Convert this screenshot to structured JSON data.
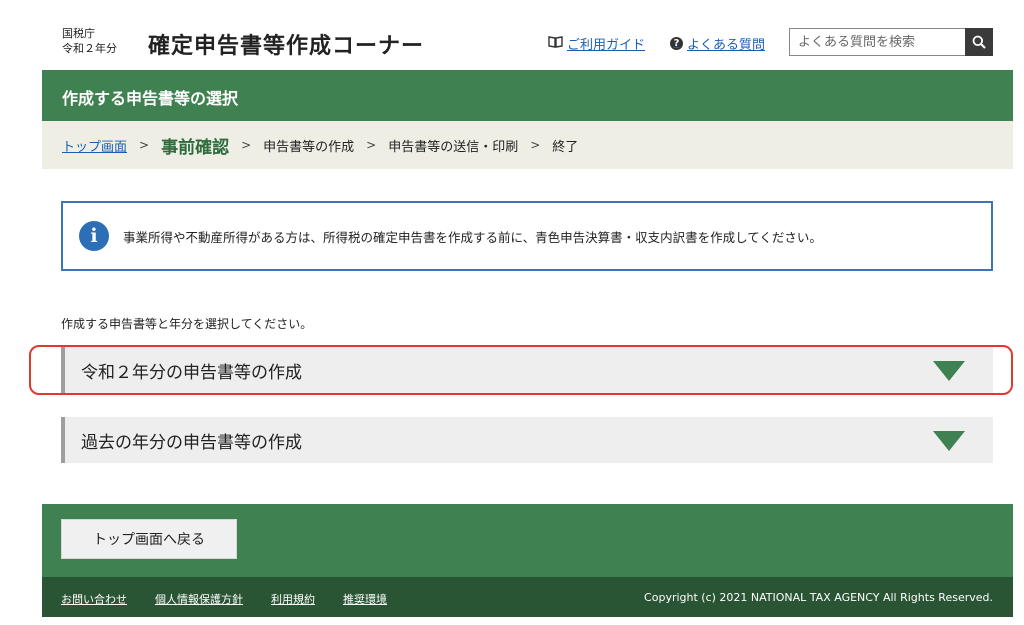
{
  "header": {
    "agency_line1": "国税庁",
    "agency_line2": "令和２年分",
    "title": "確定申告書等作成コーナー",
    "guide_link": "ご利用ガイド",
    "faq_link": "よくある質問",
    "search_placeholder": "よくある質問を検索"
  },
  "page": {
    "heading": "作成する申告書等の選択"
  },
  "breadcrumb": {
    "top": "トップ画面",
    "current": "事前確認",
    "step3": "申告書等の作成",
    "step4": "申告書等の送信・印刷",
    "step5": "終了",
    "separator": ">"
  },
  "notice": {
    "text": "事業所得や不動産所得がある方は、所得税の確定申告書を作成する前に、青色申告決算書・収支内訳書を作成してください。"
  },
  "lead": "作成する申告書等と年分を選択してください。",
  "accordions": [
    {
      "label": "令和２年分の申告書等の作成"
    },
    {
      "label": "過去の年分の申告書等の作成"
    }
  ],
  "footer": {
    "back_button": "トップ画面へ戻る",
    "links": [
      "お問い合わせ",
      "個人情報保護方針",
      "利用規約",
      "推奨環境"
    ],
    "copyright": "Copyright (c) 2021 NATIONAL TAX AGENCY All Rights Reserved."
  },
  "colors": {
    "brand_green": "#3f8150",
    "dark_green": "#2a5534",
    "info_blue": "#2c6fb7",
    "highlight_red": "#e03a2f"
  }
}
